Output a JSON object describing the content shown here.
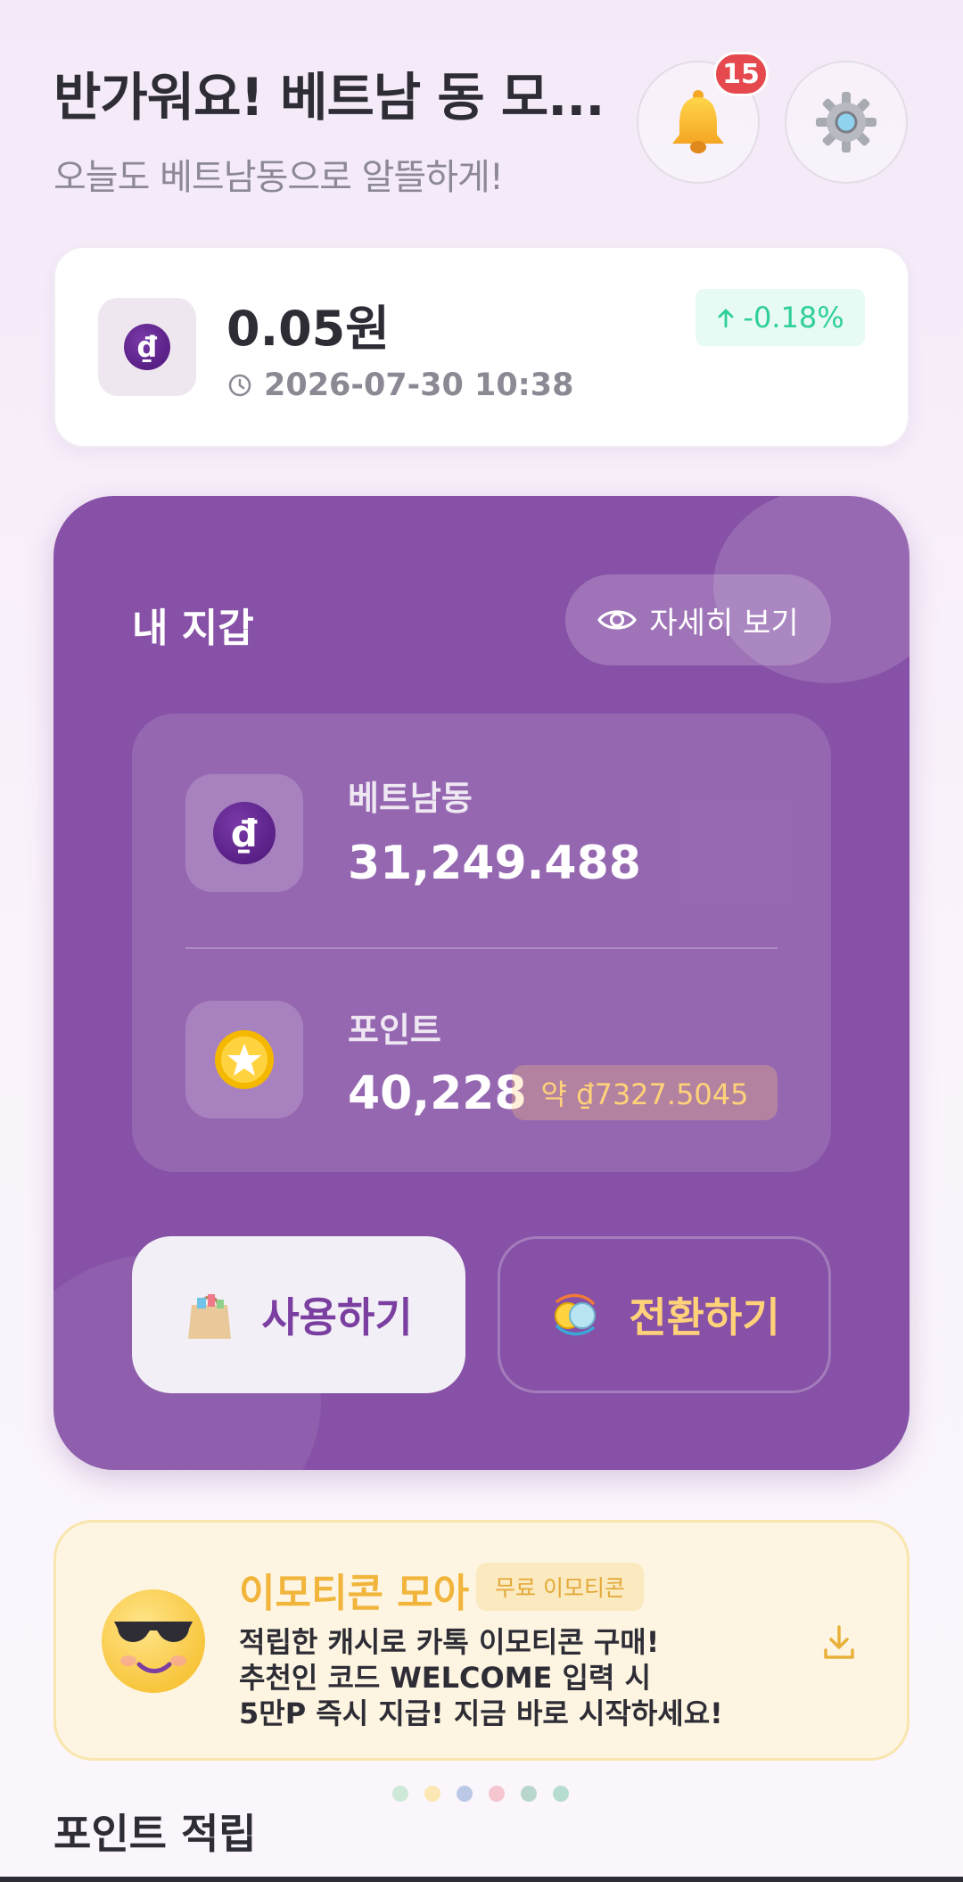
{
  "header": {
    "greeting": "반가워요! 베트남 동 모...",
    "subtitle": "오늘도 베트남동으로 알뜰하게!",
    "notification_count": "15",
    "bell_icon": "bell-icon",
    "settings_icon": "gear-icon"
  },
  "rate": {
    "value": "0.05원",
    "timestamp": "2026-07-30 10:38",
    "change": "-0.18%",
    "change_color": "#2ecf9a",
    "currency_symbol": "₫"
  },
  "wallet": {
    "title": "내 지갑",
    "detail_label": "자세히 보기",
    "dong": {
      "label": "베트남동",
      "value": "31,249.488",
      "symbol": "₫"
    },
    "points": {
      "label": "포인트",
      "value": "40,228",
      "approx": "약 ₫7327.5045"
    },
    "use_label": "사용하기",
    "convert_label": "전환하기",
    "accent_color": "#8651a6"
  },
  "promo": {
    "title": "이모티콘 모아",
    "badge": "무료 이모티콘",
    "lines": [
      "적립한 캐시로 카톡 이모티콘 구매!",
      "추천인 코드 WELCOME 입력 시",
      "5만P 즉시 지급! 지금 바로 시작하세요!"
    ]
  },
  "carousel_dots": [
    "#cfe9d8",
    "#fbe7b4",
    "#bcc9e6",
    "#f5c6d0",
    "#b9d6cc",
    "#b6dccf"
  ],
  "section": {
    "title": "포인트 적립"
  }
}
